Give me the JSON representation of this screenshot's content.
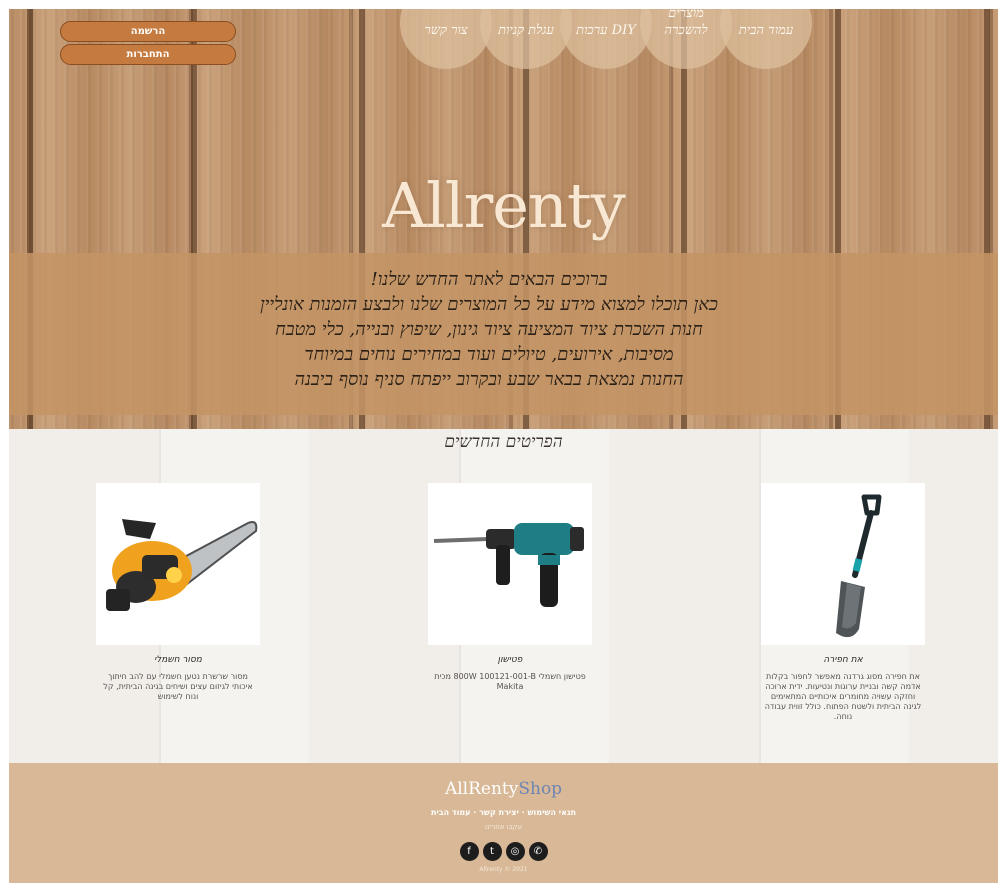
{
  "nav": {
    "items": [
      {
        "label": "עמוד הבית"
      },
      {
        "label": "מוצרים להשכרה"
      },
      {
        "label": "ערכות DIY"
      },
      {
        "label": "עגלת קניות"
      },
      {
        "label": "צור קשר"
      }
    ]
  },
  "auth": {
    "register_label": "הרשמה",
    "login_label": "התחברות"
  },
  "hero": {
    "brand": "Allrenty",
    "welcome_lines": [
      "ברוכים הבאים לאתר החדש שלנו!",
      "כאן תוכלו למצוא מידע על כל המוצרים שלנו ולבצע הזמנות אונליין",
      "חנות השכרת ציוד המציעה ציוד גינון, שיפוץ ובנייה, כלי מטבח",
      "מסיבות, אירועים, טיולים ועוד במחירים נוחים במיוחד",
      "החנות נמצאת בבאר שבע ובקרוב ייפתח סניף נוסף ביבנה"
    ]
  },
  "products": {
    "title": "הפריטים החדשים",
    "items": [
      {
        "name": "את חפירה",
        "icon": "spade-image",
        "desc": "את חפירה מסוג גרדנה מאפשר לחפור בקלות אדמה קשה ובניית ערוגות ונטיעות. ידית ארוכה וחזקה עשויה מחומרים איכותיים המתאימים לגינה הביתית ולשטח הפתוח. כולל זווית עבודה נוחה."
      },
      {
        "name": "פטישון",
        "icon": "drill-image",
        "desc": "פטישון חשמלי 800W 100121-001-B מכית Makita"
      },
      {
        "name": "מסור חשמלי",
        "icon": "chainsaw-image",
        "desc": "מסור שרשרת נטען חשמלי עם להב חיתוך איכותי לגיזום עצים ושיחים בגינה הביתית, קל ונוח לשימוש"
      }
    ]
  },
  "footer": {
    "logo_a": "AllRenty",
    "logo_b": "Shop",
    "links": "תנאי השימוש · יצירת קשר · עמוד הבית",
    "small": "עקבו אחרינו",
    "socials": [
      {
        "icon": "facebook-icon",
        "glyph": "f"
      },
      {
        "icon": "twitter-icon",
        "glyph": "t"
      },
      {
        "icon": "instagram-icon",
        "glyph": "◎"
      },
      {
        "icon": "whatsapp-icon",
        "glyph": "✆"
      }
    ],
    "copyright": "Allrenty © 2021"
  },
  "colors": {
    "band": "#c49464",
    "auth_button": "#c57a3f",
    "footer": "#d8b896",
    "logo_accent": "#6d86b4"
  }
}
